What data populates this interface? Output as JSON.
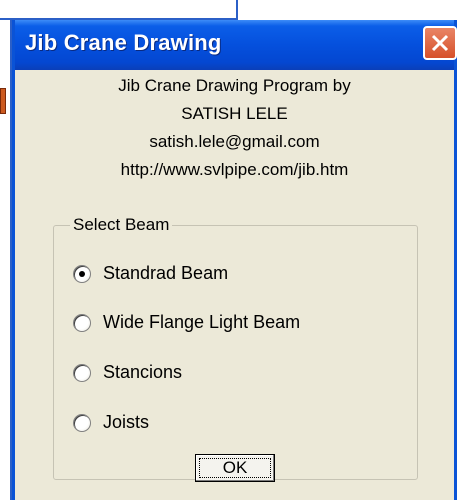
{
  "window": {
    "title": "Jib Crane Drawing",
    "close_icon": "close-icon"
  },
  "info": {
    "line1": "Jib Crane Drawing Program by",
    "line2": "SATISH LELE",
    "line3": "satish.lele@gmail.com",
    "line4": "http://www.svlpipe.com/jib.htm"
  },
  "beam_group": {
    "legend": "Select Beam",
    "options": [
      {
        "label": "Standrad Beam",
        "selected": true
      },
      {
        "label": "Wide Flange Light Beam",
        "selected": false
      },
      {
        "label": "Stancions",
        "selected": false
      },
      {
        "label": "Joists",
        "selected": false
      }
    ]
  },
  "buttons": {
    "ok_label": "OK"
  },
  "colors": {
    "titlebar": "#0550dd",
    "dialog_bg": "#ece9d8",
    "close_button": "#d6502a"
  }
}
